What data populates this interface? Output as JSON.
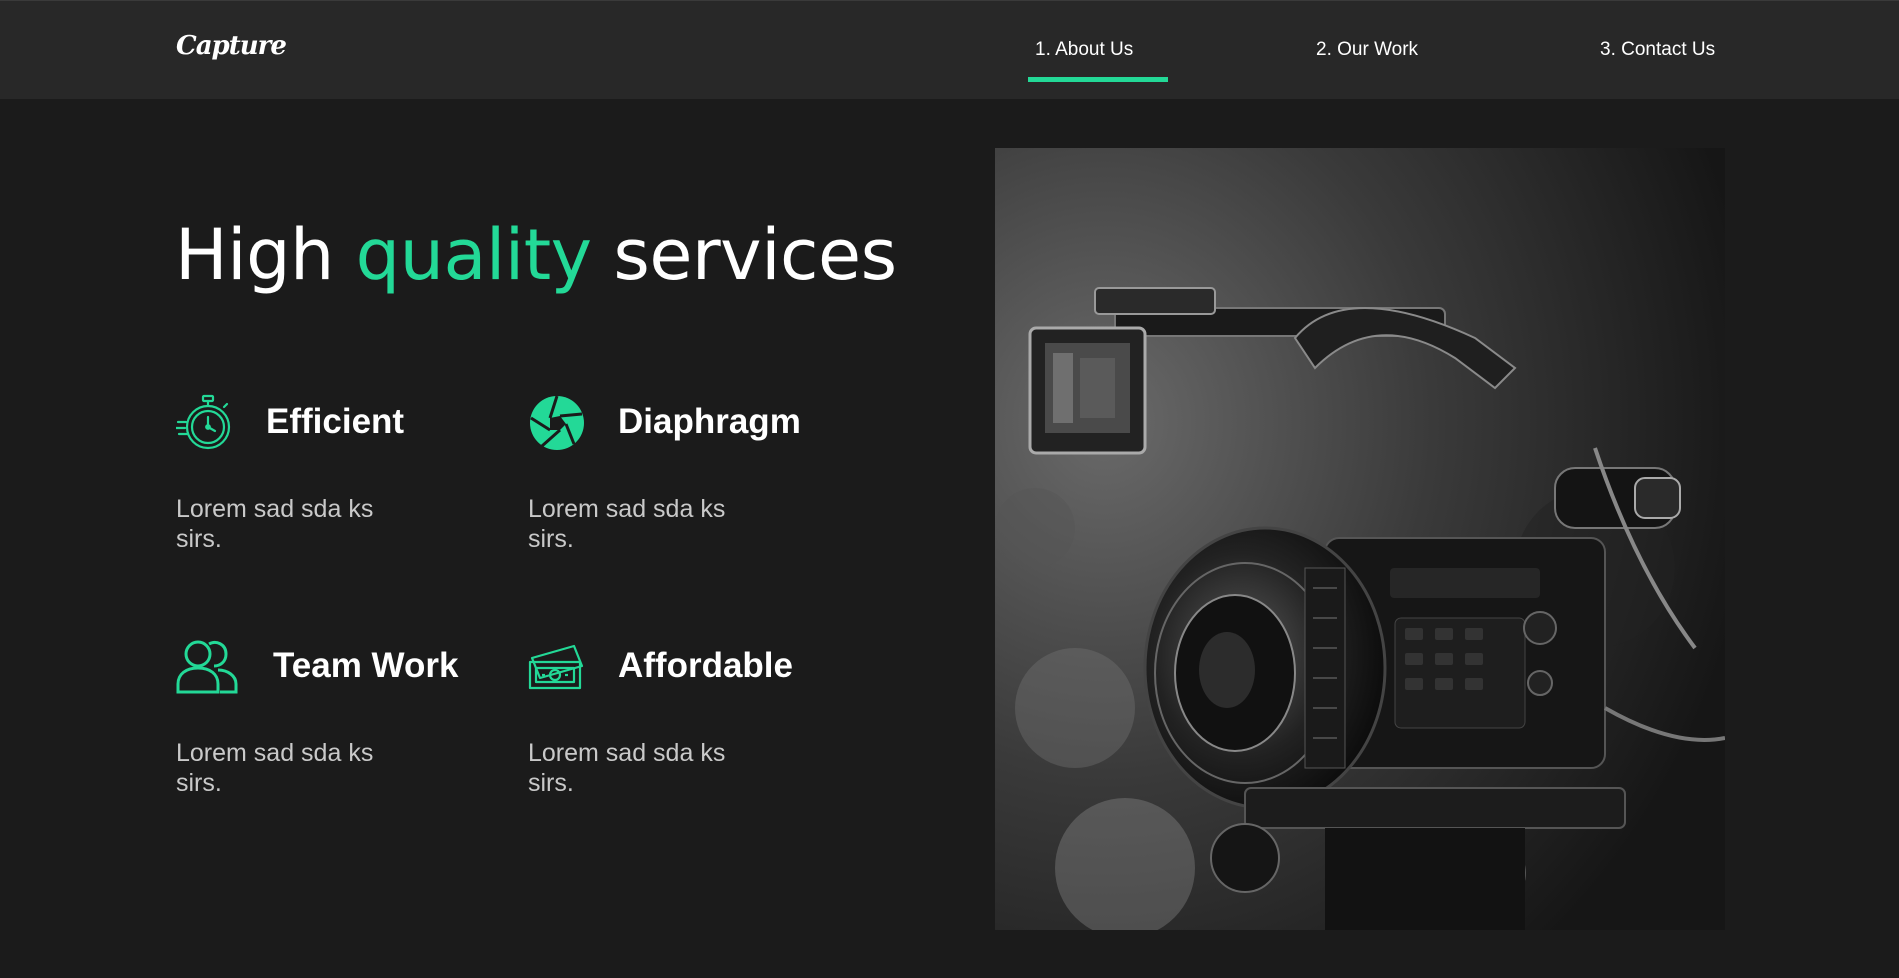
{
  "header": {
    "logo": "Capture",
    "nav": [
      {
        "label": "1. About Us",
        "active": true
      },
      {
        "label": "2. Our Work",
        "active": false
      },
      {
        "label": "3. Contact Us",
        "active": false
      }
    ]
  },
  "hero": {
    "title_part1": "High ",
    "title_accent": "quality",
    "title_part2": " services"
  },
  "features": [
    {
      "title": "Efficient",
      "description": "Lorem sad sda ks sirs.",
      "icon": "stopwatch-icon"
    },
    {
      "title": "Diaphragm",
      "description": "Lorem sad sda ks sirs.",
      "icon": "aperture-icon"
    },
    {
      "title": "Team Work",
      "description": "Lorem sad sda ks sirs.",
      "icon": "team-icon"
    },
    {
      "title": "Affordable",
      "description": "Lorem sad sda ks sirs.",
      "icon": "money-icon"
    }
  ],
  "colors": {
    "accent": "#23d997",
    "background": "#1b1b1b",
    "header": "#282828"
  }
}
